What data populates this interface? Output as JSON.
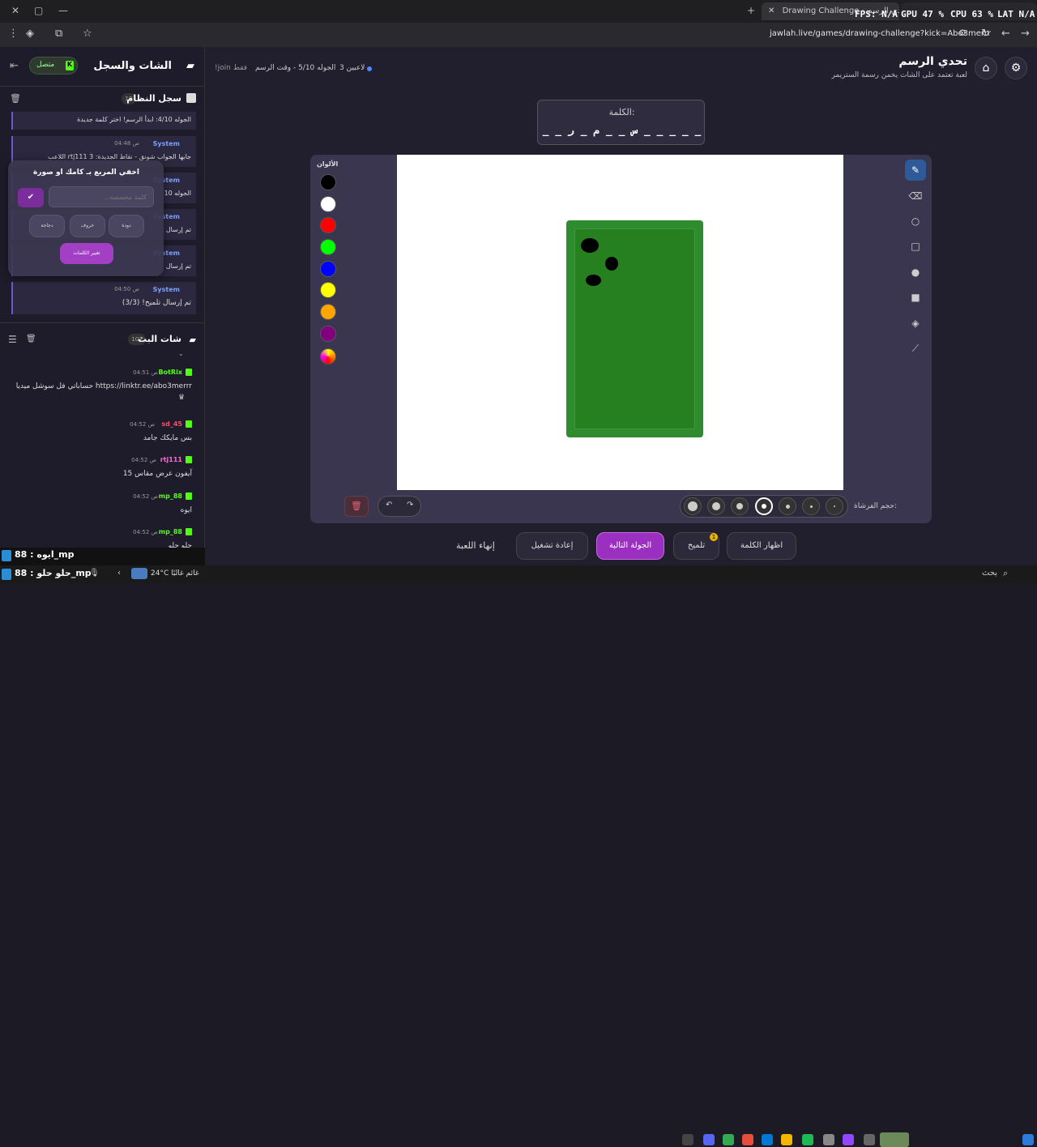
{
  "browser": {
    "tab_title": "Drawing Challenge - تحدي الرسم",
    "overlay_fps": "FPS: N/A",
    "overlay_gpu": "GPU 47 %",
    "overlay_cpu": "CPU 63 %",
    "overlay_lat": "LAT N/A",
    "url": "jawlah.live/games/drawing-challenge?kick=Abo3merrr"
  },
  "header": {
    "title": "تحدي الرسم",
    "subtitle": "لعبة تعتمد على الشات يخمن رسمة الستريمر",
    "players": "3 لاعبين",
    "round_info": "الجوله 5/10 - وقت الرسم",
    "join_hint": "!join فقط"
  },
  "word": {
    "label": "الكلمة:",
    "hint": "_ _   س _ _ م   _ ر _   _ _ _ _"
  },
  "colors_label": "الألوان",
  "brush_label": "حجم الفرشاة:",
  "controls": {
    "end_game": "إنهاء اللعبة",
    "restart": "إعادة تشغيل",
    "next_round": "الجولة التالية",
    "hint": "تلميح",
    "hint_badge": "1",
    "reveal_word": "اظهار الكلمة"
  },
  "sidebar": {
    "title": "الشات والسجل",
    "status": "متصل",
    "log_title": "سجل النظام",
    "log_count": "18",
    "log": [
      {
        "name": "",
        "time": "",
        "text": "الجوله 4/10: ابدأ الرسم! اختر كلمة جديدة"
      },
      {
        "name": "System",
        "time": "04:48 ص",
        "text": "اللاعب rtj111 جابها الجواب شونق - نقاط الجديدة: 3"
      },
      {
        "name": "System",
        "time": "",
        "text": "الجوله 10"
      },
      {
        "name": "System",
        "time": "",
        "text": "تم إرسال"
      },
      {
        "name": "System",
        "time": "",
        "text": "تم إرسال"
      },
      {
        "name": "System",
        "time": "04:50 ص",
        "text": "تم إرسال تلميح! (3/3)"
      }
    ],
    "chat_title": "شات البث",
    "chat_count": "107",
    "chat": [
      {
        "name": "BotRix",
        "color": "#53fc18",
        "time": "04:51 ص",
        "text": "حساباتي فل سوشل ميديا https://linktr.ee/abo3merrr"
      },
      {
        "name": "sd_45",
        "color": "#ff4d6d",
        "time": "04:52 ص",
        "text": "بس مايكك جامد"
      },
      {
        "name": "rtj111",
        "color": "#ff6ad5",
        "time": "04:52 ص",
        "text": "آيفون عرض مقاس 15"
      },
      {
        "name": "mp_88",
        "color": "#53fc18",
        "time": "04:52 ص",
        "text": "ايوه"
      },
      {
        "name": "mp_88",
        "color": "#53fc18",
        "time": "04:52 ص",
        "text": "حلو حلو"
      }
    ]
  },
  "popup": {
    "title": "اخفي المربع بـ كامك او صورة",
    "input_placeholder": "كلمة مخصصة...",
    "options": [
      "دجاجة",
      "خروف",
      "دودة"
    ],
    "change_words": "تغيير الكلمات"
  },
  "stream_overlay": {
    "line1": "ايوه : 88_mp",
    "line2": "حلو حلو : 88_mp"
  },
  "taskbar": {
    "search": "بحث",
    "weather": "24°C  غائم غالبًا"
  },
  "palette": [
    "#000000",
    "#ffffff",
    "#ff0000",
    "#00ff00",
    "#0000ff",
    "#ffff00",
    "#ffa500",
    "#800080"
  ]
}
